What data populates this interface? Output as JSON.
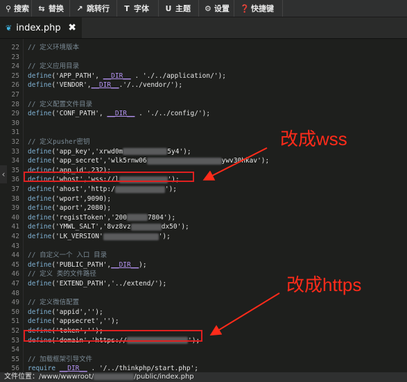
{
  "toolbar": {
    "items": [
      {
        "icon": "search-icon",
        "label": "搜索"
      },
      {
        "icon": "replace-icon",
        "label": "替换"
      },
      {
        "icon": "goto-line-icon",
        "label": "跳转行"
      },
      {
        "icon": "font-icon",
        "label": "字体"
      },
      {
        "icon": "theme-icon",
        "label": "主题"
      },
      {
        "icon": "gear-icon",
        "label": "设置"
      },
      {
        "icon": "shortcut-icon",
        "label": "快捷键"
      }
    ]
  },
  "tab": {
    "icon": "file-leaf-icon",
    "filename": "index.php",
    "close_symbol": "✖"
  },
  "editor": {
    "lines": [
      {
        "n": "22",
        "parts": [
          [
            "cm",
            "// 定义环境版本"
          ]
        ]
      },
      {
        "n": "23",
        "parts": []
      },
      {
        "n": "24",
        "parts": [
          [
            "cm",
            "// 定义应用目录"
          ]
        ]
      },
      {
        "n": "25",
        "parts": [
          [
            "kw",
            "define"
          ],
          [
            "st",
            "('APP_PATH', "
          ],
          [
            "ds",
            "__DIR__"
          ],
          [
            "st",
            " . './../application/');"
          ]
        ]
      },
      {
        "n": "26",
        "parts": [
          [
            "kw",
            "define"
          ],
          [
            "st",
            "('VENDOR',"
          ],
          [
            "ds",
            "__DIR__"
          ],
          [
            "st",
            ".'/../vendor/');"
          ]
        ]
      },
      {
        "n": "27",
        "parts": []
      },
      {
        "n": "28",
        "parts": [
          [
            "cm",
            "// 定义配置文件目录"
          ]
        ]
      },
      {
        "n": "29",
        "parts": [
          [
            "kw",
            "define"
          ],
          [
            "st",
            "('CONF_PATH', "
          ],
          [
            "ds",
            "__DIR__"
          ],
          [
            "st",
            " . './../config/');"
          ]
        ]
      },
      {
        "n": "30",
        "parts": []
      },
      {
        "n": "31",
        "parts": []
      },
      {
        "n": "32",
        "parts": [
          [
            "cm",
            "// 定义pusher密钥"
          ]
        ]
      },
      {
        "n": "33",
        "parts": [
          [
            "kw",
            "define"
          ],
          [
            "st",
            "('app_key','xrwd0m"
          ],
          [
            "blur",
            "64"
          ],
          [
            "st",
            "5y4');"
          ]
        ]
      },
      {
        "n": "34",
        "parts": [
          [
            "kw",
            "define"
          ],
          [
            "st",
            "('app_secret','wlk5rnw06"
          ],
          [
            "blur",
            "108"
          ],
          [
            "st",
            "ywv30hkav');"
          ]
        ]
      },
      {
        "n": "35",
        "parts": [
          [
            "kw",
            "define"
          ],
          [
            "st",
            "('app_id',232);"
          ]
        ]
      },
      {
        "n": "36",
        "parts": [
          [
            "kw",
            "define"
          ],
          [
            "st",
            "('whost','wss://l"
          ],
          [
            "blur",
            "70"
          ],
          [
            "st",
            "');"
          ]
        ]
      },
      {
        "n": "37",
        "parts": [
          [
            "kw",
            "define"
          ],
          [
            "st",
            "('ahost','http:/"
          ],
          [
            "blur",
            "72"
          ],
          [
            "st",
            "');"
          ]
        ]
      },
      {
        "n": "38",
        "parts": [
          [
            "kw",
            "define"
          ],
          [
            "st",
            "('wport',9090);"
          ]
        ]
      },
      {
        "n": "39",
        "parts": [
          [
            "kw",
            "define"
          ],
          [
            "st",
            "('aport',2080);"
          ]
        ]
      },
      {
        "n": "40",
        "parts": [
          [
            "kw",
            "define"
          ],
          [
            "st",
            "('registToken','200"
          ],
          [
            "blur",
            "30"
          ],
          [
            "st",
            "7804');"
          ]
        ]
      },
      {
        "n": "41",
        "parts": [
          [
            "kw",
            "define"
          ],
          [
            "st",
            "('YMWL_SALT','8vz8vz"
          ],
          [
            "blur",
            "44"
          ],
          [
            "st",
            "dx50');"
          ]
        ]
      },
      {
        "n": "42",
        "parts": [
          [
            "kw",
            "define"
          ],
          [
            "st",
            "('LK_VERSION'"
          ],
          [
            "blur",
            "80"
          ],
          [
            "st",
            "');"
          ]
        ]
      },
      {
        "n": "43",
        "parts": []
      },
      {
        "n": "44",
        "parts": [
          [
            "cm",
            "// 自定义一个 入口 目录"
          ]
        ]
      },
      {
        "n": "45",
        "parts": [
          [
            "kw",
            "define"
          ],
          [
            "st",
            "('PUBLIC_PATH',"
          ],
          [
            "ds",
            "__DIR__"
          ],
          [
            "st",
            ");"
          ]
        ]
      },
      {
        "n": "46",
        "parts": [
          [
            "cm",
            "// 定义 类的文件路径"
          ]
        ]
      },
      {
        "n": "47",
        "parts": [
          [
            "kw",
            "define"
          ],
          [
            "st",
            "('EXTEND_PATH','../extend/');"
          ]
        ]
      },
      {
        "n": "48",
        "parts": []
      },
      {
        "n": "49",
        "parts": [
          [
            "cm",
            "// 定义微信配置"
          ]
        ]
      },
      {
        "n": "50",
        "parts": [
          [
            "kw",
            "define"
          ],
          [
            "st",
            "('appid','');"
          ]
        ]
      },
      {
        "n": "51",
        "parts": [
          [
            "kw",
            "define"
          ],
          [
            "st",
            "('appsecret','');"
          ]
        ]
      },
      {
        "n": "52",
        "parts": [
          [
            "kw",
            "define"
          ],
          [
            "st",
            "('token','');"
          ]
        ]
      },
      {
        "n": "53",
        "parts": [
          [
            "kw",
            "define"
          ],
          [
            "st",
            "('domain','https://"
          ],
          [
            "blur",
            "88"
          ],
          [
            "st",
            "');"
          ]
        ]
      },
      {
        "n": "54",
        "parts": []
      },
      {
        "n": "55",
        "parts": [
          [
            "cm",
            "// 加载框架引导文件"
          ]
        ]
      },
      {
        "n": "56",
        "parts": [
          [
            "kw",
            "require"
          ],
          [
            "st",
            " "
          ],
          [
            "ds",
            "__DIR__"
          ],
          [
            "st",
            " . '/../thinkphp/start.php';"
          ]
        ]
      }
    ]
  },
  "annotations": {
    "wss_note": "改成wss",
    "https_note": "改成https"
  },
  "status": {
    "label": "文件位置：",
    "path_prefix": "/www/wwwroot/",
    "path_suffix": "/public/index.php"
  },
  "colors": {
    "annotation": "#ff2b1a",
    "keyword": "#7fb1d3",
    "comment": "#7a8a95",
    "dir_const": "#b392f0"
  }
}
